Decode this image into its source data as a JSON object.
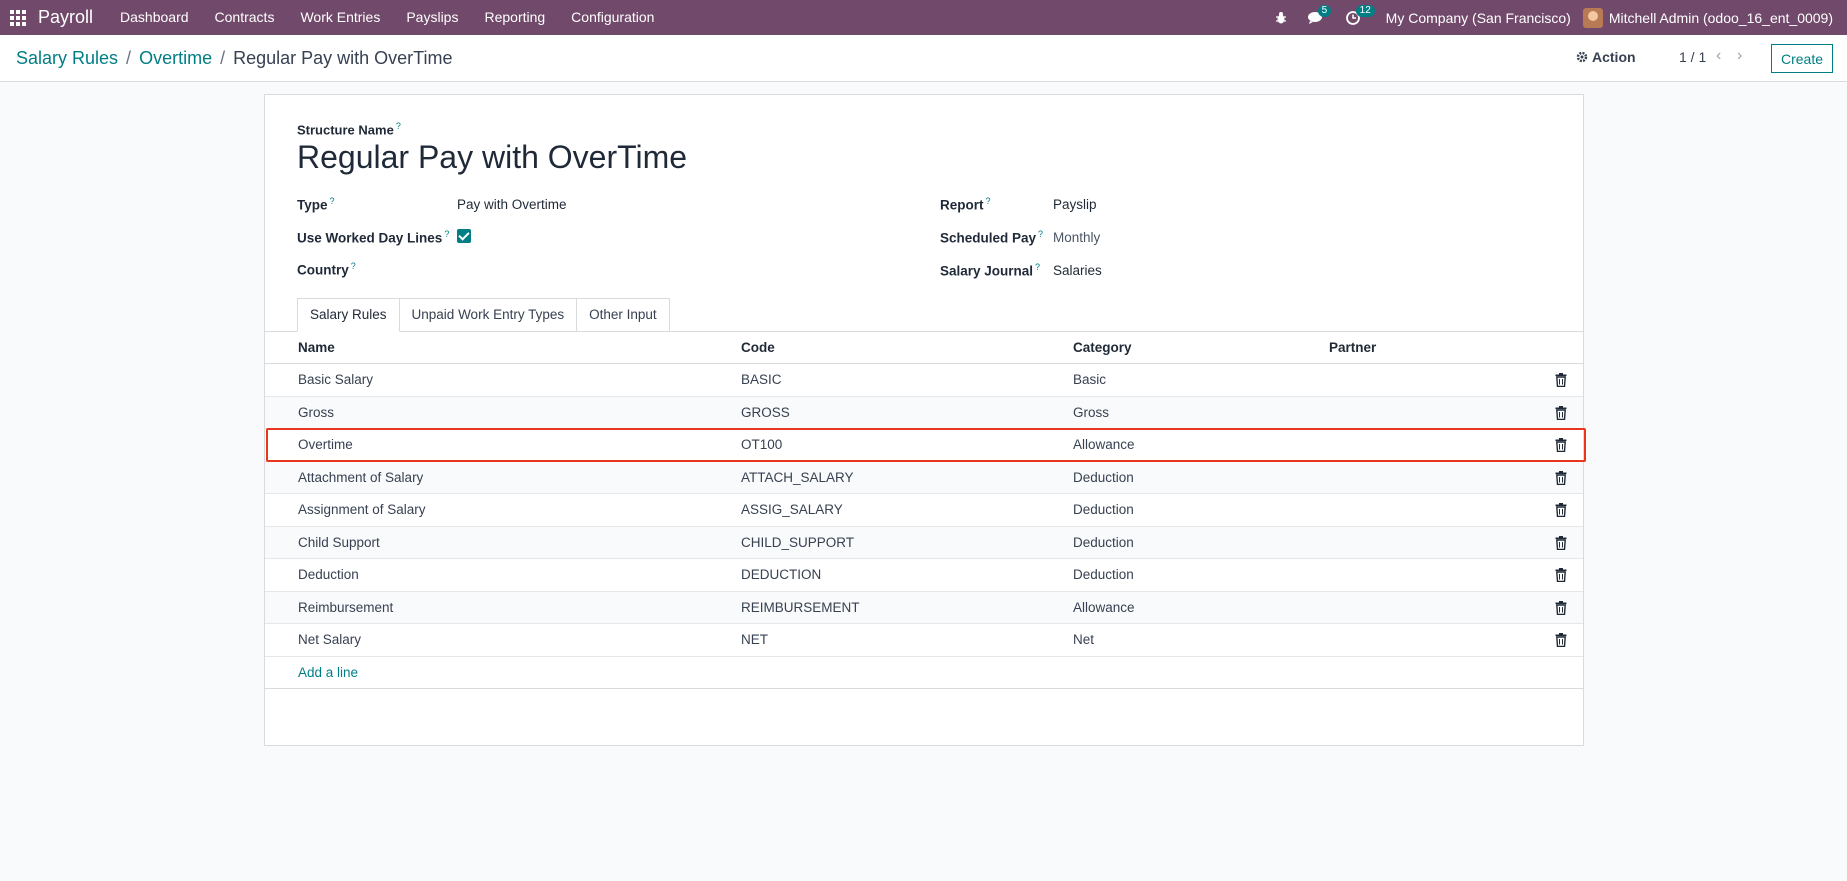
{
  "navbar": {
    "app_name": "Payroll",
    "menu": [
      "Dashboard",
      "Contracts",
      "Work Entries",
      "Payslips",
      "Reporting",
      "Configuration"
    ],
    "messages_count": "5",
    "activities_count": "12",
    "company": "My Company (San Francisco)",
    "user": "Mitchell Admin (odoo_16_ent_0009)"
  },
  "breadcrumb": {
    "items": [
      "Salary Rules",
      "Overtime"
    ],
    "current": "Regular Pay with OverTime"
  },
  "control": {
    "action_label": "Action",
    "pager": "1 / 1",
    "create_label": "Create"
  },
  "form": {
    "structure_name_label": "Structure Name",
    "structure_name": "Regular Pay with OverTime",
    "type_label": "Type",
    "type_value": "Pay with Overtime",
    "use_worked_label": "Use Worked Day Lines",
    "use_worked_checked": true,
    "country_label": "Country",
    "country_value": "",
    "report_label": "Report",
    "report_value": "Payslip",
    "scheduled_pay_label": "Scheduled Pay",
    "scheduled_pay_value": "Monthly",
    "salary_journal_label": "Salary Journal",
    "salary_journal_value": "Salaries"
  },
  "tabs": [
    "Salary Rules",
    "Unpaid Work Entry Types",
    "Other Input"
  ],
  "table": {
    "headers": [
      "Name",
      "Code",
      "Category",
      "Partner"
    ],
    "rows": [
      {
        "name": "Basic Salary",
        "code": "BASIC",
        "category": "Basic",
        "partner": ""
      },
      {
        "name": "Gross",
        "code": "GROSS",
        "category": "Gross",
        "partner": ""
      },
      {
        "name": "Overtime",
        "code": "OT100",
        "category": "Allowance",
        "partner": ""
      },
      {
        "name": "Attachment of Salary",
        "code": "ATTACH_SALARY",
        "category": "Deduction",
        "partner": ""
      },
      {
        "name": "Assignment of Salary",
        "code": "ASSIG_SALARY",
        "category": "Deduction",
        "partner": ""
      },
      {
        "name": "Child Support",
        "code": "CHILD_SUPPORT",
        "category": "Deduction",
        "partner": ""
      },
      {
        "name": "Deduction",
        "code": "DEDUCTION",
        "category": "Deduction",
        "partner": ""
      },
      {
        "name": "Reimbursement",
        "code": "REIMBURSEMENT",
        "category": "Allowance",
        "partner": ""
      },
      {
        "name": "Net Salary",
        "code": "NET",
        "category": "Net",
        "partner": ""
      }
    ],
    "add_line_label": "Add a line"
  },
  "colors": {
    "navbar": "#71496a",
    "accent": "#017e84",
    "highlight": "#e8371d"
  }
}
